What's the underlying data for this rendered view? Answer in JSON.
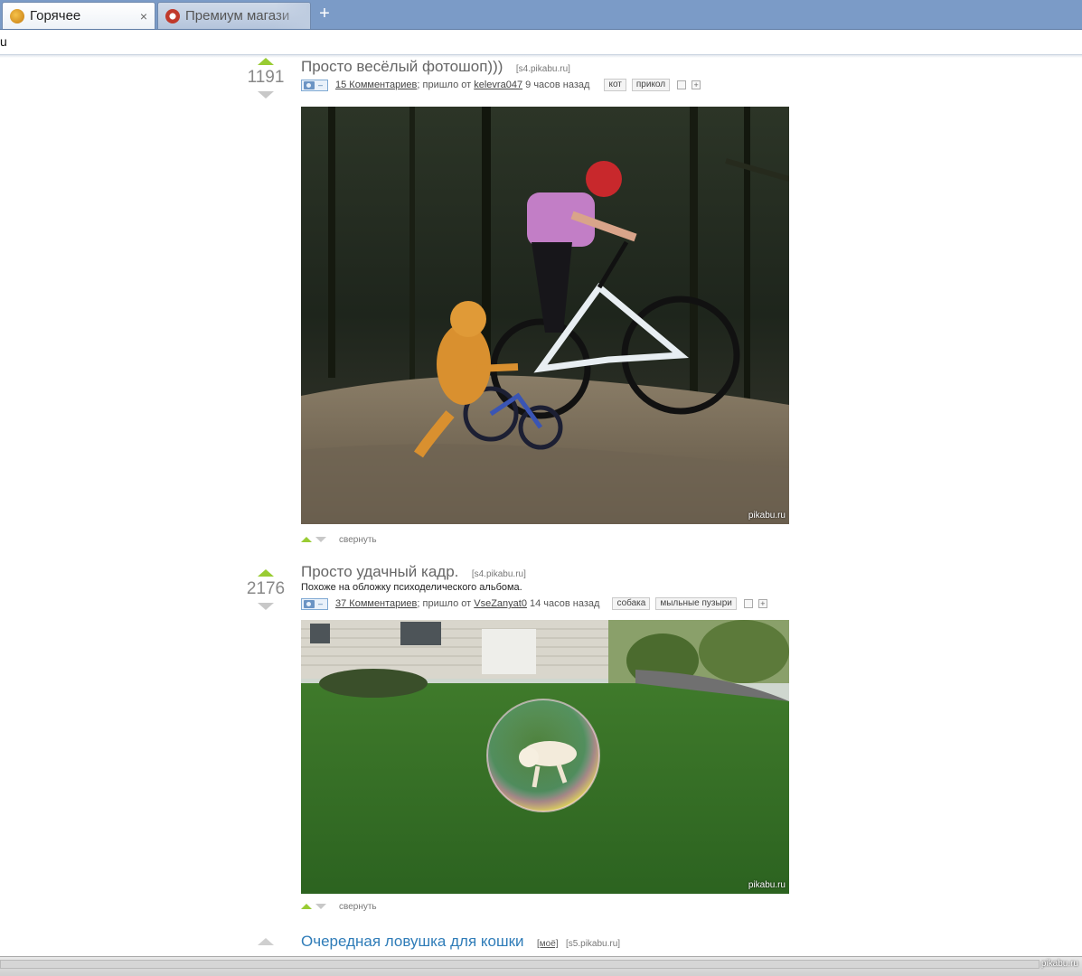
{
  "browser": {
    "tabs": [
      {
        "label": "Горячее",
        "active": true
      },
      {
        "label": "Премиум магази",
        "active": false
      }
    ],
    "new_tab": "+",
    "close": "×",
    "address": "u"
  },
  "posts": [
    {
      "score": "1191",
      "title": "Просто весёлый фотошоп)))",
      "source": "[s4.pikabu.ru]",
      "comments": "15 Комментариев",
      "from_text": "; пришло от",
      "author": "kelevra047",
      "time": "9 часов назад",
      "tags": [
        "кот",
        "прикол"
      ],
      "watermark": "pikabu.ru",
      "collapse": "свернуть"
    },
    {
      "score": "2176",
      "title": "Просто удачный кадр.",
      "source": "[s4.pikabu.ru]",
      "description": "Похоже на обложку психоделического альбома.",
      "comments": "37 Комментариев",
      "from_text": "; пришло от",
      "author": "VseZanyat0",
      "time": "14 часов назад",
      "tags": [
        "собака",
        "мыльные пузыри"
      ],
      "watermark": "pikabu.ru",
      "collapse": "свернуть"
    },
    {
      "title": "Очередная ловушка для кошки",
      "mine": "[моё]",
      "source": "[s5.pikabu.ru]"
    }
  ],
  "camera_label": "–",
  "status_watermark": "pikabu.ru",
  "colors": {
    "tab_bar": "#7b9bc7",
    "vote_up": "#99cc33",
    "title_link": "#2f7cb8"
  }
}
